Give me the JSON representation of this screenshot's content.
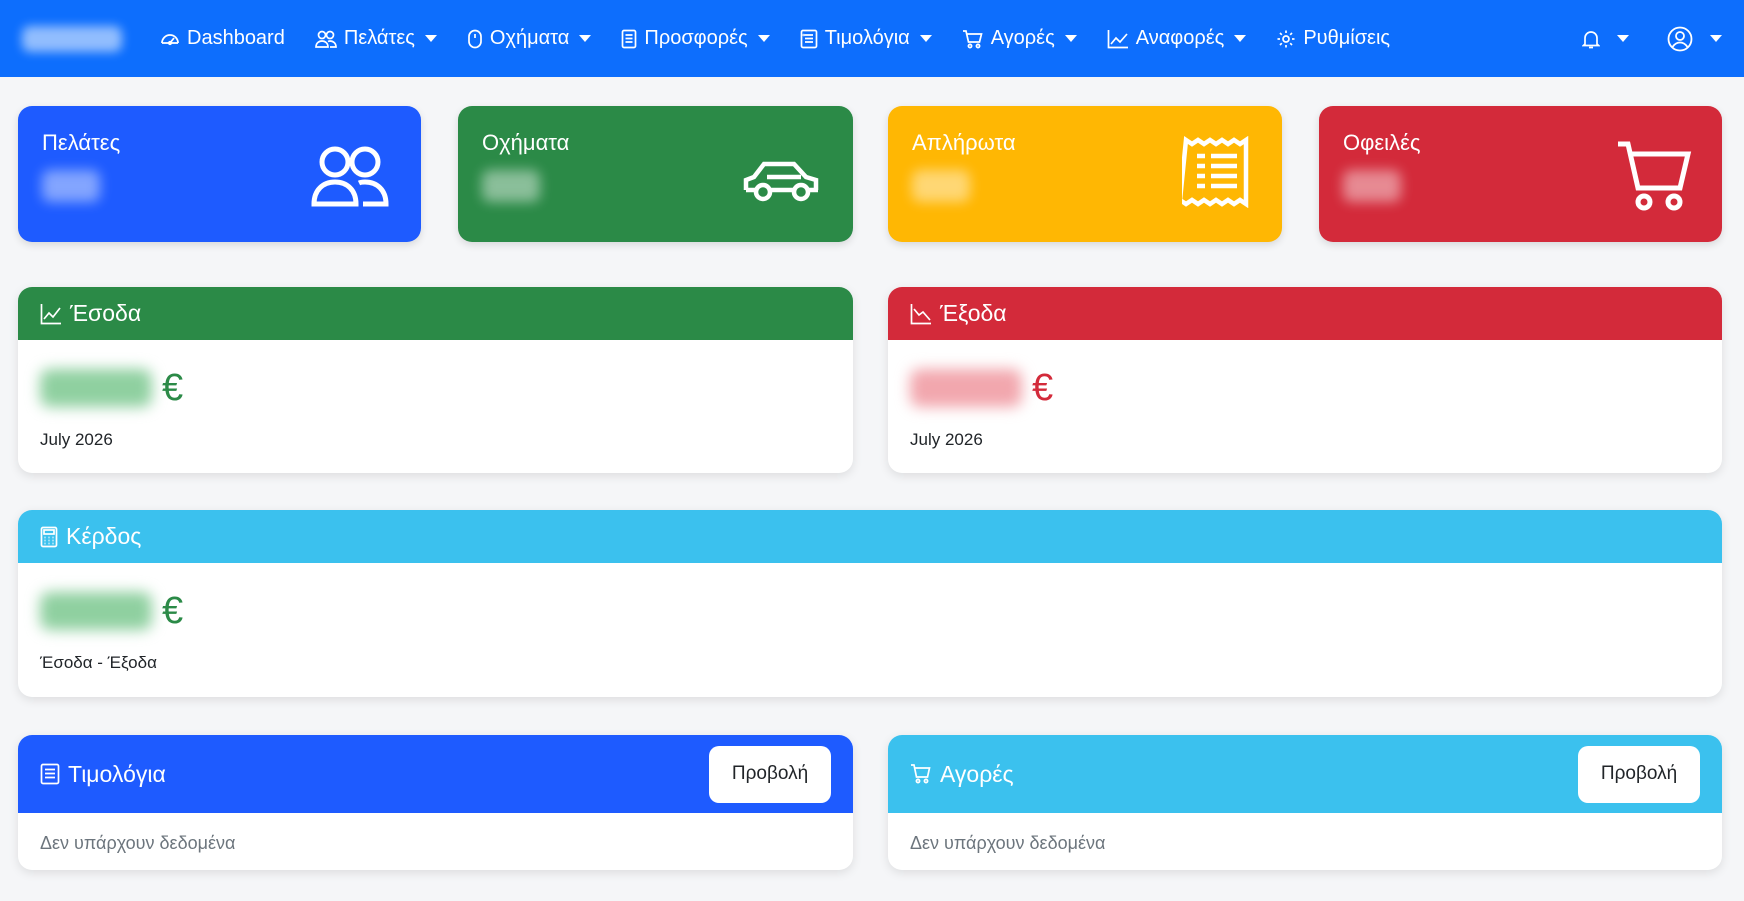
{
  "nav": {
    "dashboard": "Dashboard",
    "clients": "Πελάτες",
    "vehicles": "Οχήματα",
    "offers": "Προσφορές",
    "invoices": "Τιμολόγια",
    "purchases": "Αγορές",
    "reports": "Αναφορές",
    "settings": "Ρυθμίσεις"
  },
  "stats": {
    "clients": {
      "title": "Πελάτες",
      "color": "#1e5bff"
    },
    "vehicles": {
      "title": "Οχήματα",
      "color": "#2b8a47"
    },
    "unpaid": {
      "title": "Απλήρωτα",
      "color": "#ffb703"
    },
    "debts": {
      "title": "Οφειλές",
      "color": "#d32a3a"
    }
  },
  "income": {
    "title": "Έσοδα",
    "currency": "€",
    "period": "July 2026",
    "color": "#2b8a47"
  },
  "expenses": {
    "title": "Έξοδα",
    "currency": "€",
    "period": "July 2026",
    "color": "#d32a3a"
  },
  "profit": {
    "title": "Κέρδος",
    "currency": "€",
    "formula": "Έσοδα - Έξοδα",
    "color": "#3bc1ee"
  },
  "invoices_panel": {
    "title": "Τιμολόγια",
    "button": "Προβολή",
    "empty": "Δεν υπάρχουν δεδομένα"
  },
  "purchases_panel": {
    "title": "Αγορές",
    "button": "Προβολή",
    "empty": "Δεν υπάρχουν δεδομένα"
  }
}
